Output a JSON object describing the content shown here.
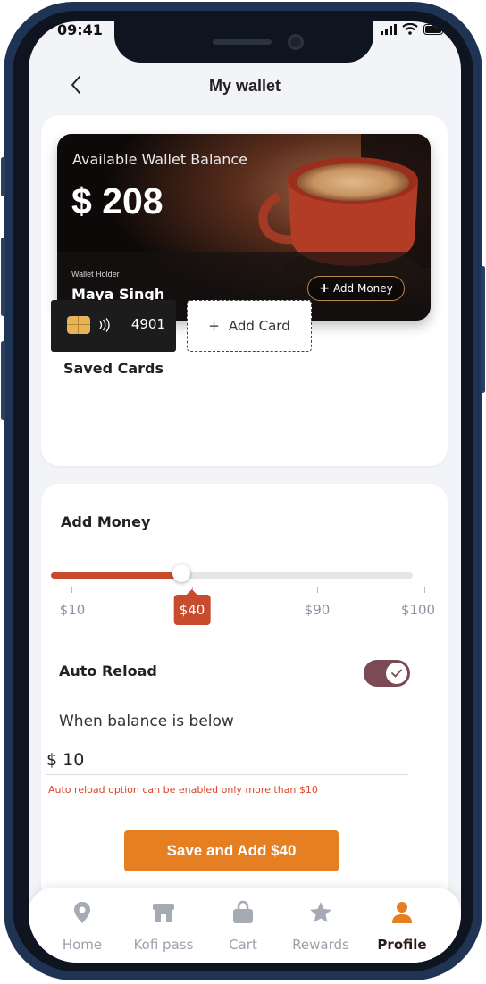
{
  "status": {
    "time": "09:41"
  },
  "header": {
    "title": "My wallet"
  },
  "wallet": {
    "balance_label": "Available Wallet Balance",
    "balance": "$ 208",
    "holder_label": "Wallet Holder",
    "holder_name": "Maya Singh",
    "add_money_label": "Add Money"
  },
  "saved_cards": {
    "title": "Saved Cards",
    "cards": [
      {
        "last4": "4901"
      }
    ],
    "add_card_label": "Add Card"
  },
  "add_money": {
    "title": "Add Money",
    "options": [
      "$10",
      "$40",
      "$90",
      "$100"
    ],
    "selected": "$40",
    "selected_fraction": 0.36
  },
  "auto_reload": {
    "label": "Auto Reload",
    "enabled": true,
    "threshold_label": "When balance is below",
    "threshold_value": "$ 10",
    "hint": "Auto reload option can be enabled only more than $10"
  },
  "save_button_label": "Save and Add $40",
  "nav": {
    "items": [
      {
        "label": "Home",
        "icon": "location-pin-icon"
      },
      {
        "label": "Kofi pass",
        "icon": "store-icon"
      },
      {
        "label": "Cart",
        "icon": "bag-icon"
      },
      {
        "label": "Rewards",
        "icon": "star-icon"
      },
      {
        "label": "Profile",
        "icon": "person-icon",
        "active": true
      }
    ]
  },
  "colors": {
    "accent_orange": "#e67e22",
    "slider_red": "#c84b2e",
    "toggle_plum": "#7b4a55"
  }
}
